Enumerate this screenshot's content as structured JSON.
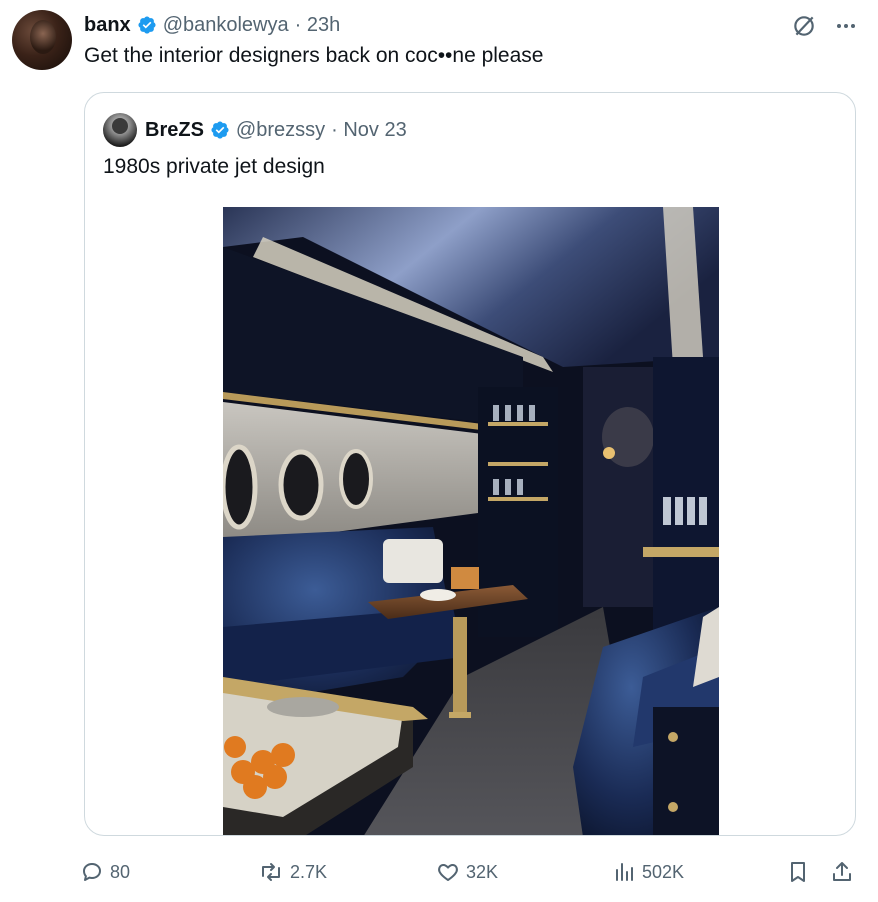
{
  "tweet": {
    "author_name": "banx",
    "author_handle": "@bankolewya",
    "time": "· 23h",
    "text": "Get the interior designers back on coc••ne please"
  },
  "quote": {
    "author_name": "BreZS",
    "author_handle": "@brezssy",
    "time": "· Nov 23",
    "text": "1980s private jet design"
  },
  "actions": {
    "replies": "80",
    "reposts": "2.7K",
    "likes": "32K",
    "views": "502K"
  },
  "colors": {
    "verified": "#1d9bf0",
    "secondary_text": "#536471",
    "border": "#cfd9de"
  },
  "icons": [
    "verified-icon",
    "grok-icon",
    "more-icon",
    "reply-icon",
    "repost-icon",
    "like-icon",
    "views-icon",
    "bookmark-icon",
    "share-icon"
  ]
}
